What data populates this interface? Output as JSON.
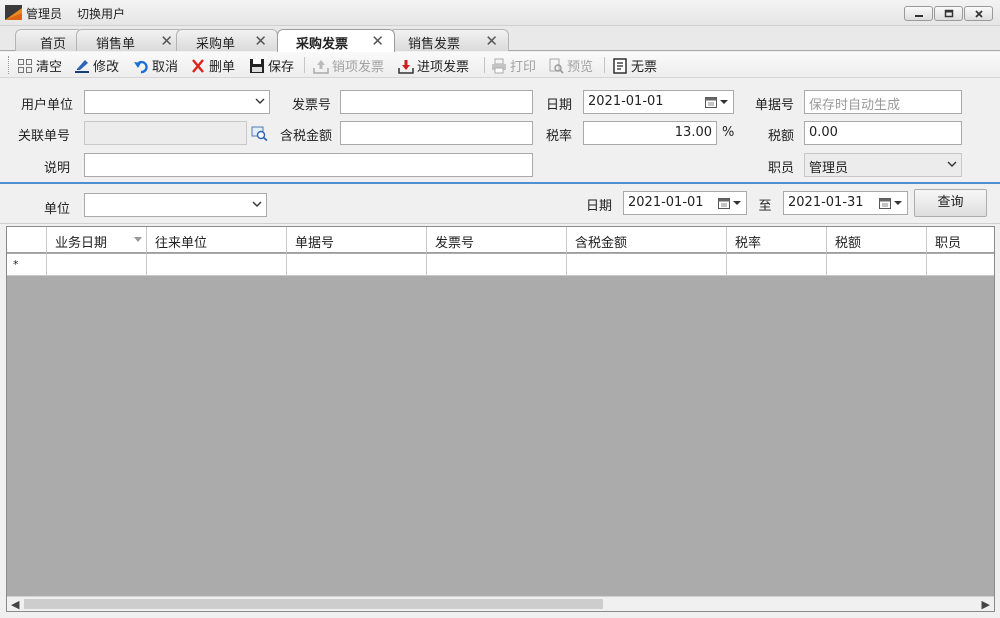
{
  "titlebar": {
    "user": "管理员",
    "switch_user": "切换用户"
  },
  "tabs": [
    {
      "label": "首页",
      "closable": false
    },
    {
      "label": "销售单",
      "closable": true
    },
    {
      "label": "采购单",
      "closable": true
    },
    {
      "label": "采购发票",
      "closable": true,
      "active": true
    },
    {
      "label": "销售发票",
      "closable": true
    }
  ],
  "tab_close_glyph": "✕",
  "toolbar": {
    "clear": "清空",
    "edit": "修改",
    "cancel": "取消",
    "delete": "删单",
    "save": "保存",
    "sales_invoice": "销项发票",
    "purchase_invoice": "进项发票",
    "print": "打印",
    "preview": "预览",
    "no_invoice": "无票"
  },
  "form": {
    "customer_label": "用户单位",
    "customer_value": "",
    "invoice_no_label": "发票号",
    "invoice_no_value": "",
    "date_label": "日期",
    "date_value": "2021-01-01",
    "doc_no_label": "单据号",
    "doc_no_placeholder": "保存时自动生成",
    "related_no_label": "关联单号",
    "related_no_value": "",
    "amount_label": "含税金额",
    "amount_value": "",
    "tax_rate_label": "税率",
    "tax_rate_value": "13.00",
    "tax_rate_unit": "%",
    "tax_label": "税额",
    "tax_value": "0.00",
    "note_label": "说明",
    "note_value": "",
    "staff_label": "职员",
    "staff_value": "管理员"
  },
  "filter": {
    "unit_label": "单位",
    "unit_value": "",
    "date_label": "日期",
    "date_from": "2021-01-01",
    "to_label": "至",
    "date_to": "2021-01-31",
    "query": "查询"
  },
  "grid": {
    "columns": [
      "业务日期",
      "往来单位",
      "单据号",
      "发票号",
      "含税金额",
      "税率",
      "税额",
      "职员"
    ],
    "new_row_marker": "*"
  },
  "colors": {
    "accent_line": "#4f8ed3",
    "grid_empty": "#ababab"
  }
}
